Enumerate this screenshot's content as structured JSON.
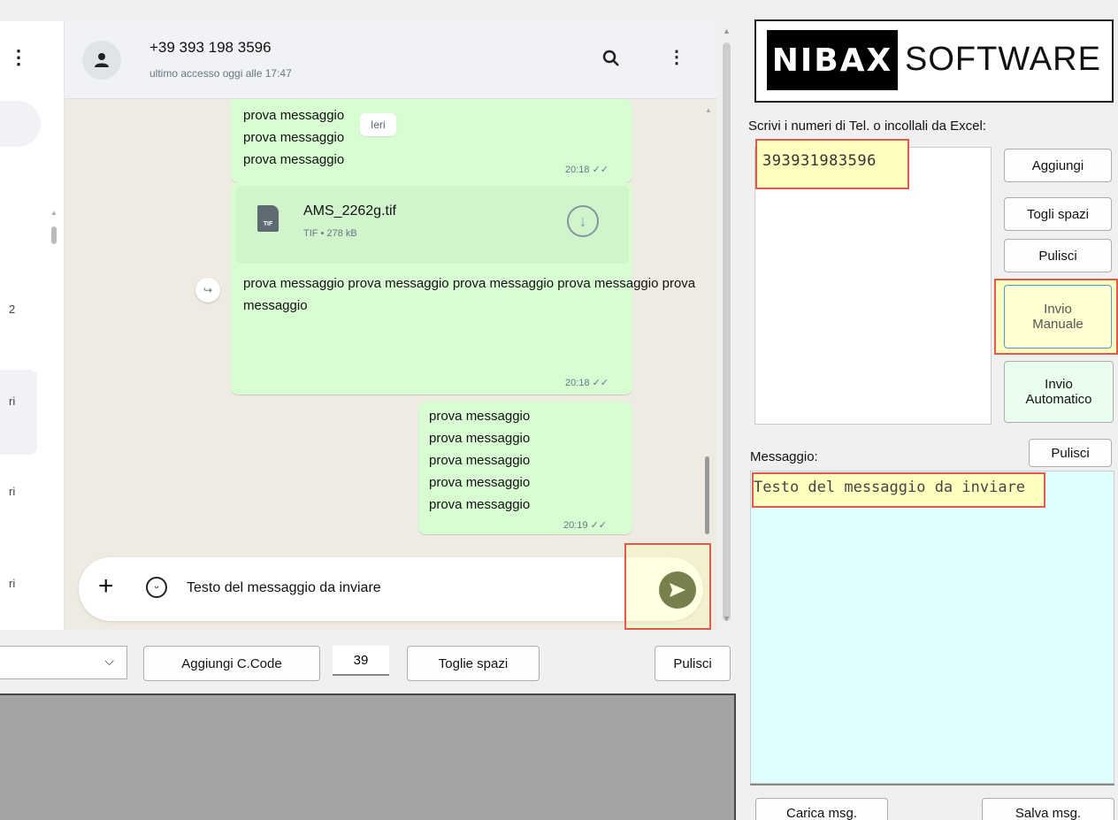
{
  "chat_list": {
    "snippets": [
      "2",
      "ri",
      "ri",
      "ri"
    ]
  },
  "chat": {
    "contact_name": "+39 393 198 3596",
    "last_seen": "ultimo accesso oggi alle 17:47",
    "date_chip": "Ieri",
    "bubble1": {
      "lines": [
        "prova messaggio",
        "prova messaggio",
        "prova messaggio"
      ],
      "time": "20:18"
    },
    "file": {
      "name": "AMS_2262g.tif",
      "meta": "TIF • 278 kB",
      "badge": "TIF"
    },
    "bubble2": {
      "lines": [
        "prova messaggio",
        "prova messaggio",
        "prova messaggio",
        "prova messaggio",
        "prova messaggio"
      ],
      "time": "20:18"
    },
    "bubble3": {
      "lines": [
        "prova messaggio",
        "prova messaggio",
        "prova messaggio",
        "prova messaggio",
        "prova messaggio"
      ],
      "time": "20:19"
    },
    "input_text": "Testo del messaggio da inviare"
  },
  "toolbar": {
    "add_code_label": "Aggiungi C.Code",
    "country_code": "39",
    "remove_spaces_label": "Toglie spazi",
    "clear_label": "Pulisci"
  },
  "right_panel": {
    "logo_left": "NIBAX",
    "logo_right": "SOFTWARE",
    "numbers_label": "Scrivi i numeri di Tel. o incollali da Excel:",
    "number_value": "393931983596",
    "add_label": "Aggiungi",
    "remove_spaces_label": "Togli spazi",
    "clear_label": "Pulisci",
    "manual_send_line1": "Invio",
    "manual_send_line2": "Manuale",
    "auto_send_line1": "Invio",
    "auto_send_line2": "Automatico",
    "message_label": "Messaggio:",
    "message_clear_label": "Pulisci",
    "message_value": "Testo del messaggio da inviare",
    "load_label": "Carica msg.",
    "save_label": "Salva msg."
  },
  "colors": {
    "bubble": "#d9fdd3",
    "highlight_border": "#e05a4b",
    "highlight_fill": "#ffffc0",
    "message_area": "#e0ffff"
  }
}
